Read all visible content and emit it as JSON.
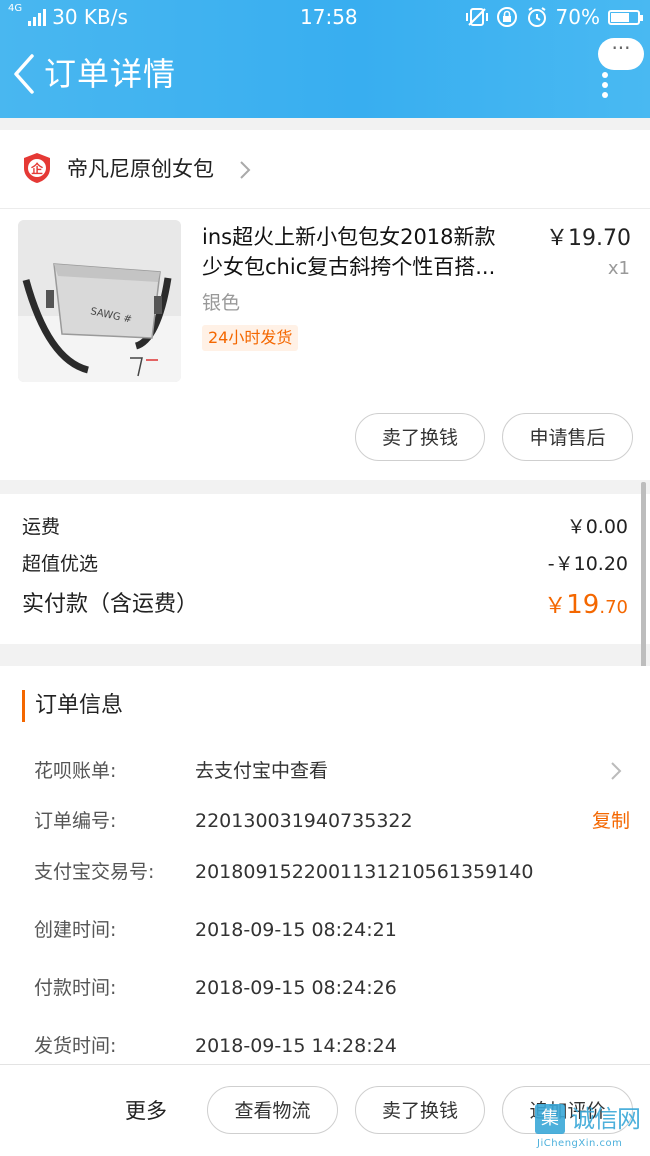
{
  "status_bar": {
    "speed": "30 KB/s",
    "network": "4G",
    "time": "17:58",
    "battery": "70%",
    "battery_level": 0.7
  },
  "nav": {
    "title": "订单详情",
    "more_label": "···"
  },
  "shop": {
    "name": "帝凡尼原创女包",
    "logo_text": "企"
  },
  "product": {
    "title_line1": "ins超火上新小包包女2018新款",
    "title_line2": "少女包chic复古斜挎个性百搭...",
    "price": "￥19.70",
    "quantity": "x1",
    "spec": "银色",
    "tag": "24小时发货",
    "image_text": "SAWG #",
    "buttons": [
      "卖了换钱",
      "申请售后"
    ]
  },
  "fees": {
    "shipping_label": "运费",
    "shipping_value": "￥0.00",
    "discount_label": "超值优选",
    "discount_value": "-￥10.20",
    "total_label": "实付款（含运费）",
    "total_currency": "￥",
    "total_int": "19",
    "total_dec": ".70"
  },
  "order_info": {
    "title": "订单信息",
    "rows": [
      {
        "label": "花呗账单:",
        "value": "去支付宝中查看"
      },
      {
        "label": "订单编号:",
        "value": "220130031940735322",
        "action": "复制"
      },
      {
        "label": "支付宝交易号:",
        "value": "2018091522001131210561359140"
      },
      {
        "label": "创建时间:",
        "value": "2018-09-15 08:24:21"
      },
      {
        "label": "付款时间:",
        "value": "2018-09-15 08:24:26"
      },
      {
        "label": "发货时间:",
        "value": "2018-09-15 14:28:24"
      }
    ]
  },
  "bottom_bar": {
    "more": "更多",
    "buttons": [
      "查看物流",
      "卖了换钱",
      "追加评价"
    ]
  },
  "watermark": {
    "box": "集",
    "text": "诚信网",
    "url": "JiChengXin.com"
  },
  "colors": {
    "accent": "#f46700",
    "header": "#38aef0"
  }
}
